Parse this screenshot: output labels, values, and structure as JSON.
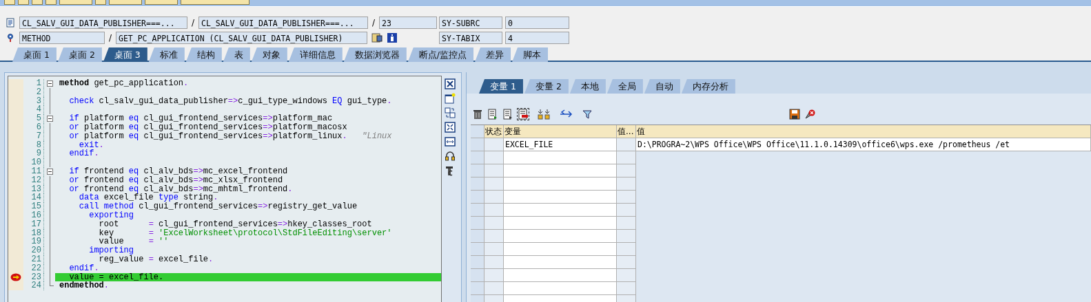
{
  "location": {
    "include": "CL_SALV_GUI_DATA_PUBLISHER===...",
    "separator_1": "/",
    "program": "CL_SALV_GUI_DATA_PUBLISHER===...",
    "separator_2": "/",
    "line": "23"
  },
  "event": {
    "type": "METHOD",
    "separator": "/",
    "name": "GET_PC_APPLICATION (CL_SALV_GUI_DATA_PUBLISHER)"
  },
  "watch": [
    {
      "name": "SY-SUBRC",
      "value": "0"
    },
    {
      "name": "SY-TABIX",
      "value": "4"
    }
  ],
  "desktop_tabs": [
    {
      "label": "桌面 1",
      "selected": false
    },
    {
      "label": "桌面 2",
      "selected": false
    },
    {
      "label": "桌面 3",
      "selected": true
    },
    {
      "label": "标准",
      "selected": false
    },
    {
      "label": "结构",
      "selected": false
    },
    {
      "label": "表",
      "selected": false
    },
    {
      "label": "对象",
      "selected": false
    },
    {
      "label": "详细信息",
      "selected": false
    },
    {
      "label": "数据浏览器",
      "selected": false
    },
    {
      "label": "断点/监控点",
      "selected": false
    },
    {
      "label": "差异",
      "selected": false
    },
    {
      "label": "脚本",
      "selected": false
    }
  ],
  "source": {
    "lines": [
      {
        "number": "1",
        "fold": true,
        "breakpoint": false,
        "current": false,
        "tokens": [
          {
            "kind": "bold",
            "text": "method"
          },
          {
            "kind": "plain",
            "text": " get_pc_application"
          },
          {
            "kind": "punct",
            "text": "."
          }
        ]
      },
      {
        "number": "2",
        "fold": false,
        "breakpoint": false,
        "current": false
      },
      {
        "number": "3",
        "fold": false,
        "breakpoint": false,
        "current": false,
        "tokens": [
          {
            "kind": "keyword",
            "text": "  check"
          },
          {
            "kind": "plain",
            "text": " cl_salv_gui_data_publisher"
          },
          {
            "kind": "punct",
            "text": "=>"
          },
          {
            "kind": "plain",
            "text": "c_gui_type_windows "
          },
          {
            "kind": "keyword",
            "text": "EQ"
          },
          {
            "kind": "plain",
            "text": " gui_type"
          },
          {
            "kind": "punct",
            "text": "."
          }
        ]
      },
      {
        "number": "4",
        "fold": false,
        "breakpoint": false,
        "current": false
      },
      {
        "number": "5",
        "fold": true,
        "breakpoint": false,
        "current": false,
        "tokens": [
          {
            "kind": "keyword",
            "text": "  if"
          },
          {
            "kind": "plain",
            "text": " platform "
          },
          {
            "kind": "keyword",
            "text": "eq"
          },
          {
            "kind": "plain",
            "text": " cl_gui_frontend_services"
          },
          {
            "kind": "punct",
            "text": "=>"
          },
          {
            "kind": "plain",
            "text": "platform_mac"
          }
        ]
      },
      {
        "number": "6",
        "fold": false,
        "breakpoint": false,
        "current": false,
        "tokens": [
          {
            "kind": "keyword",
            "text": "  or"
          },
          {
            "kind": "plain",
            "text": " platform "
          },
          {
            "kind": "keyword",
            "text": "eq"
          },
          {
            "kind": "plain",
            "text": " cl_gui_frontend_services"
          },
          {
            "kind": "punct",
            "text": "=>"
          },
          {
            "kind": "plain",
            "text": "platform_macosx"
          }
        ]
      },
      {
        "number": "7",
        "fold": false,
        "breakpoint": false,
        "current": false,
        "tokens": [
          {
            "kind": "keyword",
            "text": "  or"
          },
          {
            "kind": "plain",
            "text": " platform "
          },
          {
            "kind": "keyword",
            "text": "eq"
          },
          {
            "kind": "plain",
            "text": " cl_gui_frontend_services"
          },
          {
            "kind": "punct",
            "text": "=>"
          },
          {
            "kind": "plain",
            "text": "platform_linux"
          },
          {
            "kind": "punct",
            "text": "."
          },
          {
            "kind": "comment",
            "text": "   \"Linux"
          }
        ]
      },
      {
        "number": "8",
        "fold": false,
        "breakpoint": false,
        "current": false,
        "tokens": [
          {
            "kind": "keyword",
            "text": "    exit"
          },
          {
            "kind": "punct",
            "text": "."
          }
        ]
      },
      {
        "number": "9",
        "fold": false,
        "breakpoint": false,
        "current": false,
        "tokens": [
          {
            "kind": "keyword",
            "text": "  endif"
          },
          {
            "kind": "punct",
            "text": "."
          }
        ]
      },
      {
        "number": "10",
        "fold": false,
        "breakpoint": false,
        "current": false
      },
      {
        "number": "11",
        "fold": true,
        "breakpoint": false,
        "current": false,
        "tokens": [
          {
            "kind": "keyword",
            "text": "  if"
          },
          {
            "kind": "plain",
            "text": " frontend "
          },
          {
            "kind": "keyword",
            "text": "eq"
          },
          {
            "kind": "plain",
            "text": " cl_alv_bds"
          },
          {
            "kind": "punct",
            "text": "=>"
          },
          {
            "kind": "plain",
            "text": "mc_excel_frontend"
          }
        ]
      },
      {
        "number": "12",
        "fold": false,
        "breakpoint": false,
        "current": false,
        "tokens": [
          {
            "kind": "keyword",
            "text": "  or"
          },
          {
            "kind": "plain",
            "text": " frontend "
          },
          {
            "kind": "keyword",
            "text": "eq"
          },
          {
            "kind": "plain",
            "text": " cl_alv_bds"
          },
          {
            "kind": "punct",
            "text": "=>"
          },
          {
            "kind": "plain",
            "text": "mc_xlsx_frontend"
          }
        ]
      },
      {
        "number": "13",
        "fold": false,
        "breakpoint": false,
        "current": false,
        "tokens": [
          {
            "kind": "keyword",
            "text": "  or"
          },
          {
            "kind": "plain",
            "text": " frontend "
          },
          {
            "kind": "keyword",
            "text": "eq"
          },
          {
            "kind": "plain",
            "text": " cl_alv_bds"
          },
          {
            "kind": "punct",
            "text": "=>"
          },
          {
            "kind": "plain",
            "text": "mc_mhtml_frontend"
          },
          {
            "kind": "punct",
            "text": "."
          }
        ]
      },
      {
        "number": "14",
        "fold": false,
        "breakpoint": false,
        "current": false,
        "tokens": [
          {
            "kind": "keyword",
            "text": "    data"
          },
          {
            "kind": "plain",
            "text": " excel_file "
          },
          {
            "kind": "keyword",
            "text": "type"
          },
          {
            "kind": "plain",
            "text": " string"
          },
          {
            "kind": "punct",
            "text": "."
          }
        ]
      },
      {
        "number": "15",
        "fold": false,
        "breakpoint": false,
        "current": false,
        "tokens": [
          {
            "kind": "keyword",
            "text": "    call method"
          },
          {
            "kind": "plain",
            "text": " cl_gui_frontend_services"
          },
          {
            "kind": "punct",
            "text": "=>"
          },
          {
            "kind": "plain",
            "text": "registry_get_value"
          }
        ]
      },
      {
        "number": "16",
        "fold": false,
        "breakpoint": false,
        "current": false,
        "tokens": [
          {
            "kind": "keyword",
            "text": "      exporting"
          }
        ]
      },
      {
        "number": "17",
        "fold": false,
        "breakpoint": false,
        "current": false,
        "tokens": [
          {
            "kind": "plain",
            "text": "        root      "
          },
          {
            "kind": "punct",
            "text": "="
          },
          {
            "kind": "plain",
            "text": " cl_gui_frontend_services"
          },
          {
            "kind": "punct",
            "text": "=>"
          },
          {
            "kind": "plain",
            "text": "hkey_classes_root"
          }
        ]
      },
      {
        "number": "18",
        "fold": false,
        "breakpoint": false,
        "current": false,
        "tokens": [
          {
            "kind": "plain",
            "text": "        key       "
          },
          {
            "kind": "punct",
            "text": "="
          },
          {
            "kind": "string",
            "text": " 'ExcelWorksheet\\protocol\\StdFileEditing\\server'"
          }
        ]
      },
      {
        "number": "19",
        "fold": false,
        "breakpoint": false,
        "current": false,
        "tokens": [
          {
            "kind": "plain",
            "text": "        value     "
          },
          {
            "kind": "punct",
            "text": "="
          },
          {
            "kind": "string",
            "text": " ''"
          }
        ]
      },
      {
        "number": "20",
        "fold": false,
        "breakpoint": false,
        "current": false,
        "tokens": [
          {
            "kind": "keyword",
            "text": "      importing"
          }
        ]
      },
      {
        "number": "21",
        "fold": false,
        "breakpoint": false,
        "current": false,
        "tokens": [
          {
            "kind": "plain",
            "text": "        reg_value "
          },
          {
            "kind": "punct",
            "text": "="
          },
          {
            "kind": "plain",
            "text": " excel_file"
          },
          {
            "kind": "punct",
            "text": "."
          }
        ]
      },
      {
        "number": "22",
        "fold": false,
        "breakpoint": false,
        "current": false,
        "tokens": [
          {
            "kind": "keyword",
            "text": "  endif"
          },
          {
            "kind": "punct",
            "text": "."
          }
        ]
      },
      {
        "number": "23",
        "fold": false,
        "breakpoint": true,
        "current": true,
        "tokens": [
          {
            "kind": "plain",
            "text": "  value "
          },
          {
            "kind": "punct",
            "text": "="
          },
          {
            "kind": "plain",
            "text": " excel_file"
          },
          {
            "kind": "punct",
            "text": "."
          }
        ]
      },
      {
        "number": "24",
        "fold": false,
        "breakpoint": false,
        "current": false,
        "tokens": [
          {
            "kind": "bold",
            "text": "endmethod"
          },
          {
            "kind": "punct",
            "text": "."
          }
        ]
      }
    ]
  },
  "variable_tabs": [
    {
      "label": "变量 1",
      "selected": true
    },
    {
      "label": "变量 2",
      "selected": false
    },
    {
      "label": "本地",
      "selected": false
    },
    {
      "label": "全局",
      "selected": false
    },
    {
      "label": "自动",
      "selected": false
    },
    {
      "label": "内存分析",
      "selected": false
    }
  ],
  "variables": {
    "columns": [
      "状态",
      "变量",
      "值...",
      "值"
    ],
    "rows": [
      {
        "variable": "EXCEL_FILE",
        "value": "D:\\PROGRA~2\\WPS Office\\WPS Office\\11.1.0.14309\\office6\\wps.exe /prometheus /et"
      }
    ]
  }
}
